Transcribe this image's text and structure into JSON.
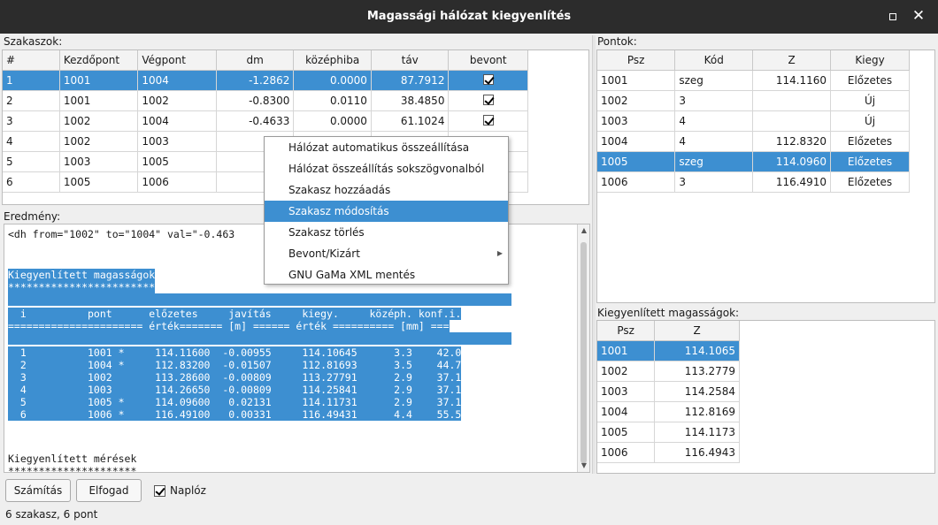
{
  "window": {
    "title": "Magassági hálózat kiegyenlítés"
  },
  "segments": {
    "label": "Szakaszok:",
    "columns": [
      "#",
      "Kezdőpont",
      "Végpont",
      "dm",
      "középhiba",
      "táv",
      "bevont"
    ],
    "rows": [
      [
        "1",
        "1001",
        "1004",
        "-1.2862",
        "0.0000",
        "87.7912",
        "checked"
      ],
      [
        "2",
        "1001",
        "1002",
        "-0.8300",
        "0.0110",
        "38.4850",
        "checked"
      ],
      [
        "3",
        "1002",
        "1004",
        "-0.4633",
        "0.0000",
        "61.1024",
        "checked"
      ],
      [
        "4",
        "1002",
        "1003",
        "0.",
        "",
        "",
        ""
      ],
      [
        "5",
        "1003",
        "1005",
        "-0.",
        "",
        "",
        ""
      ],
      [
        "6",
        "1005",
        "1006",
        "2.",
        "",
        "",
        ""
      ]
    ]
  },
  "points": {
    "label": "Pontok:",
    "columns": [
      "Psz",
      "Kód",
      "Z",
      "Kiegy"
    ],
    "rows": [
      [
        "1001",
        "szeg",
        "114.1160",
        "Előzetes"
      ],
      [
        "1002",
        "3",
        "",
        "Új"
      ],
      [
        "1003",
        "4",
        "",
        "Új"
      ],
      [
        "1004",
        "4",
        "112.8320",
        "Előzetes"
      ],
      [
        "1005",
        "szeg",
        "114.0960",
        "Előzetes"
      ],
      [
        "1006",
        "3",
        "116.4910",
        "Előzetes"
      ]
    ]
  },
  "adjusted": {
    "label": "Kiegyenlített magasságok:",
    "columns": [
      "Psz",
      "Z"
    ],
    "rows": [
      [
        "1001",
        "114.1065"
      ],
      [
        "1002",
        "113.2779"
      ],
      [
        "1003",
        "114.2584"
      ],
      [
        "1004",
        "112.8169"
      ],
      [
        "1005",
        "114.1173"
      ],
      [
        "1006",
        "116.4943"
      ]
    ]
  },
  "result": {
    "label": "Eredmény:",
    "line_top": "<dh from=\"1002\" to=\"1004\" val=\"-0.463",
    "heading": "Kiegyenlített magasságok",
    "stars": "************************",
    "header1": "  i          pont      előzetes     javítás     kiegy.     középh. konf.i.",
    "header2": "====================== érték======= [m] ====== érték ========== [mm] ===",
    "rows": [
      "  1          1001 *     114.11600  -0.00955     114.10645      3.3    42.0",
      "  2          1004 *     112.83200  -0.01507     112.81693      3.5    44.7",
      "  3          1002       113.28600  -0.00809     113.27791      2.9    37.1",
      "  4          1003       114.26650  -0.00809     114.25841      2.9    37.1",
      "  5          1005 *     114.09600   0.02131     114.11731      2.9    37.1",
      "  6          1006 *     116.49100   0.00331     116.49431      4.4    55.5"
    ],
    "footer": "Kiegyenlített mérések",
    "footer_stars": "*********************"
  },
  "context_menu": {
    "items": [
      "Hálózat automatikus összeállítása",
      "Hálózat összeállítás sokszögvonalból",
      "Szakasz hozzáadás",
      "Szakasz módosítás",
      "Szakasz törlés",
      "Bevont/Kizárt",
      "GNU GaMa XML mentés"
    ],
    "selected_index": 3
  },
  "toolbar": {
    "compute_label": "Számítás",
    "accept_label": "Elfogad",
    "log_label": "Naplóz",
    "log_checked": true
  },
  "status": {
    "text": "6 szakasz, 6 pont"
  },
  "colors": {
    "selection": "#3d8fd1",
    "titlebar": "#2c2c2c"
  }
}
